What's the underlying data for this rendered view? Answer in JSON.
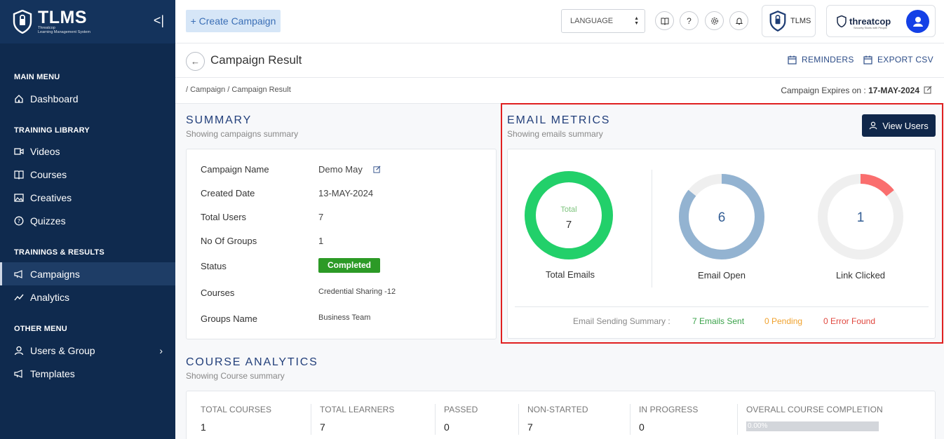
{
  "brand": {
    "title": "TLMS",
    "subtitle_line1": "Threatcop",
    "subtitle_line2": "Learning Management System"
  },
  "sidebar": {
    "collapse_icon": "<|",
    "sections": [
      {
        "heading": "MAIN MENU",
        "items": [
          {
            "label": "Dashboard",
            "icon": "home-icon"
          }
        ]
      },
      {
        "heading": "TRAINING LIBRARY",
        "items": [
          {
            "label": "Videos",
            "icon": "video-icon"
          },
          {
            "label": "Courses",
            "icon": "book-icon"
          },
          {
            "label": "Creatives",
            "icon": "image-icon"
          },
          {
            "label": "Quizzes",
            "icon": "question-icon"
          }
        ]
      },
      {
        "heading": "TRAININGS & RESULTS",
        "items": [
          {
            "label": "Campaigns",
            "icon": "megaphone-icon",
            "active": true
          },
          {
            "label": "Analytics",
            "icon": "chart-line-icon"
          }
        ]
      },
      {
        "heading": "OTHER MENU",
        "items": [
          {
            "label": "Users & Group",
            "icon": "user-icon"
          },
          {
            "label": "Templates",
            "icon": "megaphone-icon"
          }
        ]
      }
    ]
  },
  "topbar": {
    "create_label": "+ Create Campaign",
    "language_label": "LANGUAGE",
    "tlms_label": "TLMS",
    "threatcop_label": "threatcop",
    "threatcop_tagline": "Security Starts with People"
  },
  "header": {
    "title": "Campaign Result",
    "reminders_label": "REMINDERS",
    "export_label": "EXPORT CSV",
    "breadcrumb": "/ Campaign / Campaign Result",
    "expires_label": "Campaign Expires on :",
    "expires_date": "17-MAY-2024"
  },
  "summary": {
    "title": "SUMMARY",
    "subtitle": "Showing campaigns summary",
    "rows": [
      {
        "label": "Campaign Name",
        "value": "Demo May"
      },
      {
        "label": "Created Date",
        "value": "13-MAY-2024"
      },
      {
        "label": "Total Users",
        "value": "7"
      },
      {
        "label": "No Of Groups",
        "value": "1"
      },
      {
        "label": "Status",
        "value": "Completed"
      },
      {
        "label": "Courses",
        "value": "Credential Sharing -12"
      },
      {
        "label": "Groups Name",
        "value": "Business Team"
      }
    ]
  },
  "email_metrics": {
    "title": "EMAIL METRICS",
    "subtitle": "Showing emails summary",
    "view_users_label": "View Users",
    "total": {
      "caption": "Total",
      "value": "7",
      "label": "Total Emails",
      "fraction": 1.0,
      "color": "#22d06a"
    },
    "open": {
      "value": "6",
      "label": "Email Open",
      "fraction": 0.857,
      "color": "#93b3d1"
    },
    "clicked": {
      "value": "1",
      "label": "Link Clicked",
      "fraction": 0.143,
      "color": "#fa6e6e"
    },
    "track_color": "#efefef",
    "sending_summary_label": "Email Sending Summary :",
    "sent_label": "7 Emails Sent",
    "pending_label": "0 Pending",
    "error_label": "0 Error Found",
    "sent_color": "#3aa24a",
    "pending_color": "#f0a22e",
    "error_color": "#e0473e"
  },
  "course_analytics": {
    "title": "COURSE ANALYTICS",
    "subtitle": "Showing Course summary",
    "columns": [
      {
        "label": "TOTAL COURSES",
        "value": "1"
      },
      {
        "label": "TOTAL LEARNERS",
        "value": "7"
      },
      {
        "label": "PASSED",
        "value": "0"
      },
      {
        "label": "NON-STARTED",
        "value": "7"
      },
      {
        "label": "IN PROGRESS",
        "value": "0"
      },
      {
        "label": "OVERALL COURSE COMPLETION",
        "value": "0.00%",
        "fraction": 0
      }
    ]
  }
}
